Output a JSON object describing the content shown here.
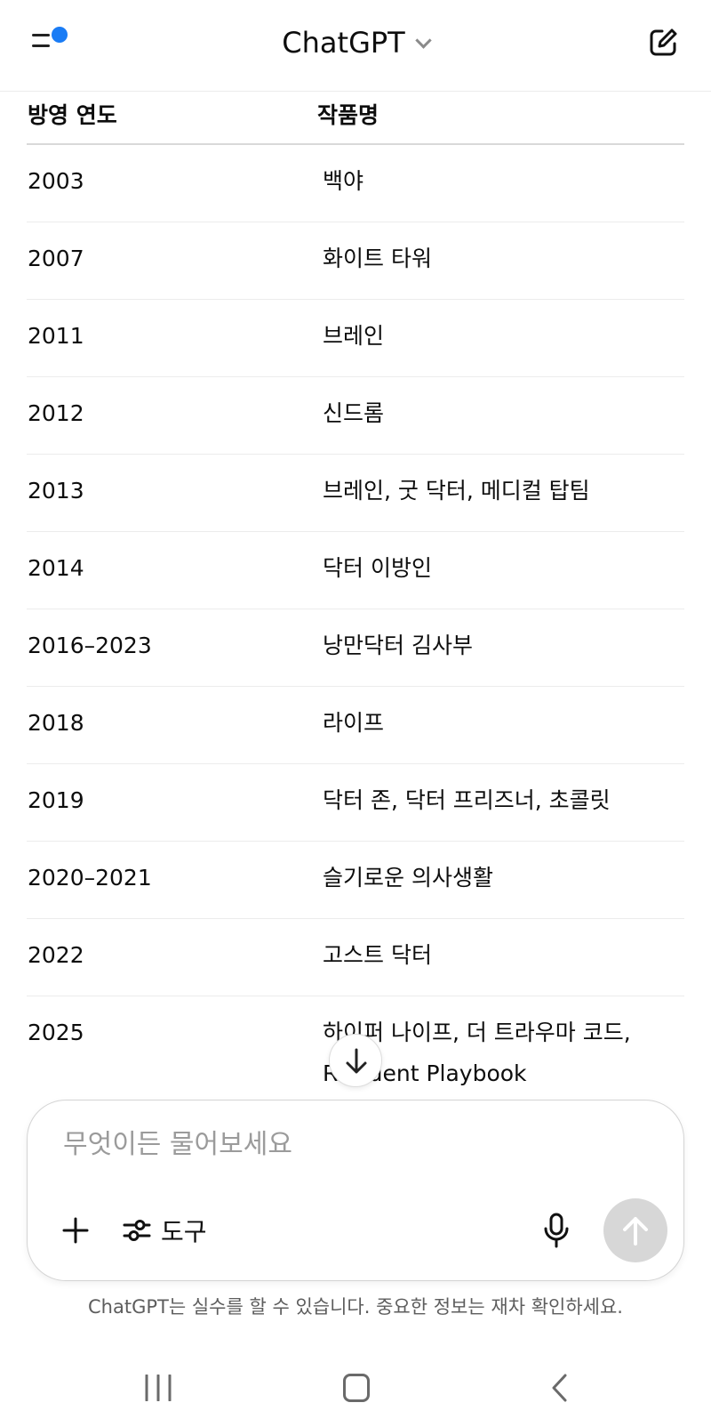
{
  "header": {
    "title": "ChatGPT",
    "accent_color": "#1a7cf5",
    "menu_icon": "menu-icon",
    "edit_icon": "new-chat-icon"
  },
  "table": {
    "headers": [
      "방영 연도",
      "작품명"
    ],
    "rows": [
      {
        "year": "2003",
        "title": "백야"
      },
      {
        "year": "2007",
        "title": "화이트 타워"
      },
      {
        "year": "2011",
        "title": "브레인"
      },
      {
        "year": "2012",
        "title": "신드롬"
      },
      {
        "year": "2013",
        "title": "브레인, 굿 닥터, 메디컬 탑팀"
      },
      {
        "year": "2014",
        "title": "닥터 이방인"
      },
      {
        "year": "2016–2023",
        "title": "낭만닥터 김사부"
      },
      {
        "year": "2018",
        "title": "라이프"
      },
      {
        "year": "2019",
        "title": "닥터 존, 닥터 프리즈너, 초콜릿"
      },
      {
        "year": "2020–2021",
        "title": "슬기로운 의사생활"
      },
      {
        "year": "2022",
        "title": "고스트 닥터"
      },
      {
        "year": "2025",
        "title": "하이퍼 나이프, 더 트라우마 코드, Resident Playbook"
      }
    ]
  },
  "composer": {
    "placeholder": "무엇이든 물어보세요",
    "value": "",
    "tools_label": "도구",
    "send_color": "#d7d7d7"
  },
  "disclaimer": "ChatGPT는 실수를 할 수 있습니다. 중요한 정보는 재차 확인하세요."
}
